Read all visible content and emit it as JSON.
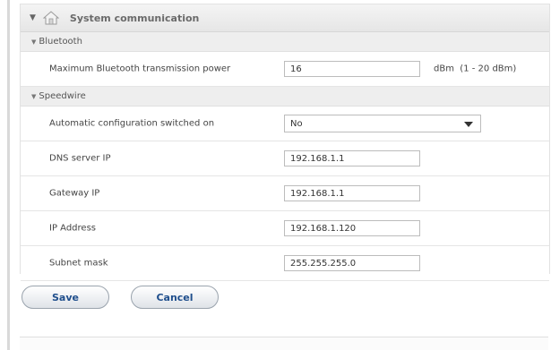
{
  "panel": {
    "title": "System communication",
    "sections": {
      "bluetooth": {
        "title": "Bluetooth",
        "max_power_label": "Maximum Bluetooth transmission power",
        "max_power_value": "16",
        "max_power_unit": "dBm  (1 - 20 dBm)"
      },
      "speedwire": {
        "title": "Speedwire",
        "auto_config_label": "Automatic configuration switched on",
        "auto_config_value": "No",
        "dns_label": "DNS server IP",
        "dns_value": "192.168.1.1",
        "gateway_label": "Gateway IP",
        "gateway_value": "192.168.1.1",
        "ip_label": "IP Address",
        "ip_value": "192.168.1.120",
        "subnet_label": "Subnet mask",
        "subnet_value": "255.255.255.0"
      }
    }
  },
  "actions": {
    "save_label": "Save",
    "cancel_label": "Cancel"
  },
  "icons": {
    "collapse": "chevron-down-icon",
    "home": "home-icon",
    "dropdown": "dropdown-arrow-icon"
  },
  "colors": {
    "button_text": "#1f4e8c",
    "section_bg": "#eeeeee",
    "header_bg": "#e6e6e6"
  }
}
